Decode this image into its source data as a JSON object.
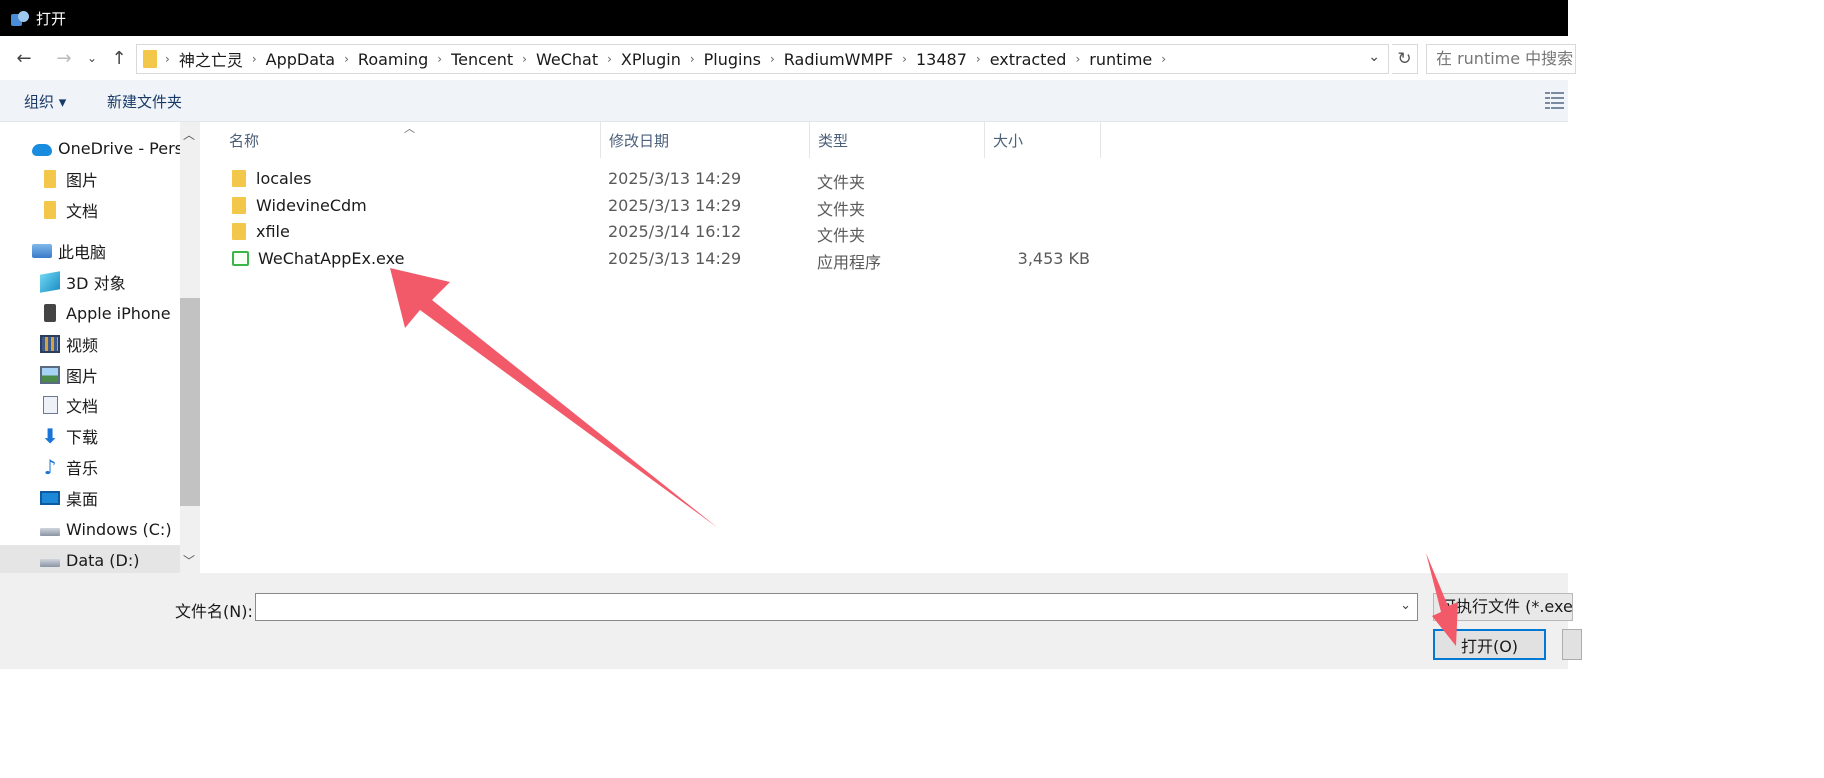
{
  "window": {
    "title": "打开"
  },
  "navbar": {
    "back_icon": "arrow-left-icon",
    "forward_icon": "arrow-right-icon",
    "recent_icon": "chevron-down-icon",
    "up_icon": "arrow-up-icon",
    "breadcrumbs": [
      "神之亡灵",
      "AppData",
      "Roaming",
      "Tencent",
      "WeChat",
      "XPlugin",
      "Plugins",
      "RadiumWMPF",
      "13487",
      "extracted",
      "runtime"
    ],
    "search_placeholder": "在 runtime 中搜索"
  },
  "toolbar": {
    "organize_label": "组织 ▾",
    "new_folder_label": "新建文件夹"
  },
  "tree": {
    "items": [
      {
        "label": "OneDrive - Personal",
        "icon": "onedrive-icon"
      },
      {
        "label": "图片",
        "icon": "folder-icon"
      },
      {
        "label": "文档",
        "icon": "folder-icon"
      },
      {
        "label": "此电脑",
        "icon": "computer-icon"
      },
      {
        "label": "3D 对象",
        "icon": "3d-objects-icon"
      },
      {
        "label": "Apple iPhone",
        "icon": "phone-icon"
      },
      {
        "label": "视频",
        "icon": "video-icon"
      },
      {
        "label": "图片",
        "icon": "pictures-icon"
      },
      {
        "label": "文档",
        "icon": "document-icon"
      },
      {
        "label": "下载",
        "icon": "download-icon"
      },
      {
        "label": "音乐",
        "icon": "music-icon"
      },
      {
        "label": "桌面",
        "icon": "desktop-icon"
      },
      {
        "label": "Windows (C:)",
        "icon": "drive-icon"
      },
      {
        "label": "Data (D:)",
        "icon": "drive-icon"
      }
    ]
  },
  "columns": {
    "name": "名称",
    "date": "修改日期",
    "type": "类型",
    "size": "大小"
  },
  "files": [
    {
      "name": "locales",
      "date": "2025/3/13 14:29",
      "type": "文件夹",
      "size": ""
    },
    {
      "name": "WidevineCdm",
      "date": "2025/3/13 14:29",
      "type": "文件夹",
      "size": ""
    },
    {
      "name": "xfile",
      "date": "2025/3/14 16:12",
      "type": "文件夹",
      "size": ""
    },
    {
      "name": "WeChatAppEx.exe",
      "date": "2025/3/13 14:29",
      "type": "应用程序",
      "size": "3,453 KB"
    }
  ],
  "bottom": {
    "filename_label": "文件名(N):",
    "filename_value": "",
    "filter_value": "可执行文件 (*.exe)",
    "open_label": "打开(O)"
  },
  "colors": {
    "accent": "#0078d4",
    "annotation_arrow": "#f25a6a",
    "folder": "#f3c84a"
  }
}
